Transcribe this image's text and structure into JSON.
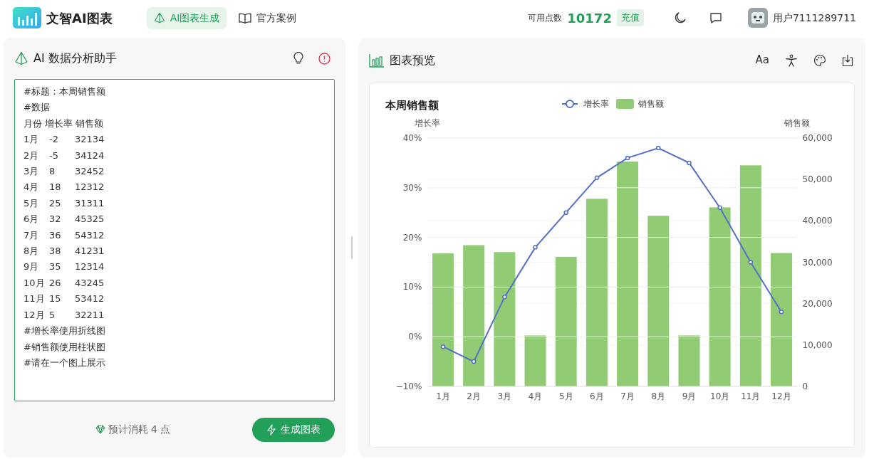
{
  "app": {
    "title": "文智AI图表"
  },
  "nav": [
    {
      "label": "AI图表生成",
      "selected": true
    },
    {
      "label": "官方案例",
      "selected": false
    }
  ],
  "account": {
    "points_label": "可用点数",
    "points": "10172",
    "recharge": "充值",
    "user": "用户7111289711"
  },
  "assistant": {
    "title": "AI 数据分析助手",
    "prompt_lines": [
      "#标题：本周销售额",
      "#数据",
      "月份 增长率 销售额",
      "1月\t-2\t32134",
      "2月\t-5\t34124",
      "3月\t8\t32452",
      "4月\t18\t12312",
      "5月\t25\t31311",
      "6月\t32\t45325",
      "7月\t36\t54312",
      "8月\t38\t41231",
      "9月\t35\t12314",
      "10月\t26\t43245",
      "11月\t15\t53412",
      "12月\t5\t32211",
      "#增长率使用折线图",
      "#销售额使用柱状图",
      "#请在一个图上展示"
    ],
    "cost": "预计消耗 4 点",
    "submit": "生成图表"
  },
  "preview": {
    "title": "图表预览",
    "font_button": "Aa",
    "bar_layer": {
      "chart_data": {
        "type": "bar",
        "title": "本周销售额",
        "ylabel": "销售额",
        "grid": true,
        "categories": [
          "1月",
          "2月",
          "3月",
          "4月",
          "5月",
          "6月",
          "7月",
          "8月",
          "9月",
          "10月",
          "11月",
          "12月"
        ],
        "series": [
          {
            "name": "销售额",
            "color": "#91cc75",
            "values": [
              32134,
              34124,
              32452,
              12312,
              31311,
              45325,
              54312,
              41231,
              12314,
              43245,
              53412,
              32211
            ]
          }
        ],
        "ylim": [
          0,
          60000
        ],
        "yticks": [
          {
            "value": 0,
            "label": "0"
          },
          {
            "value": 10000,
            "label": "10,000"
          },
          {
            "value": 20000,
            "label": "20,000"
          },
          {
            "value": 30000,
            "label": "30,000"
          },
          {
            "value": 40000,
            "label": "40,000"
          },
          {
            "value": 50000,
            "label": "50,000"
          },
          {
            "value": 60000,
            "label": "60,000"
          }
        ]
      }
    },
    "line_layer": {
      "chart_data": {
        "type": "line",
        "ylabel": "增长率",
        "grid": true,
        "series": [
          {
            "name": "增长率",
            "color": "#5470c6",
            "marker": "circle",
            "values": [
              -2,
              -5,
              8,
              18,
              25,
              32,
              36,
              38,
              35,
              26,
              15,
              5
            ]
          }
        ],
        "ylim": [
          -10,
          40
        ],
        "yticks": [
          {
            "value": -10,
            "label": "−10%"
          },
          {
            "value": 0,
            "label": "0%"
          },
          {
            "value": 10,
            "label": "10%"
          },
          {
            "value": 20,
            "label": "20%"
          },
          {
            "value": 30,
            "label": "30%"
          },
          {
            "value": 40,
            "label": "40%"
          }
        ]
      }
    }
  }
}
